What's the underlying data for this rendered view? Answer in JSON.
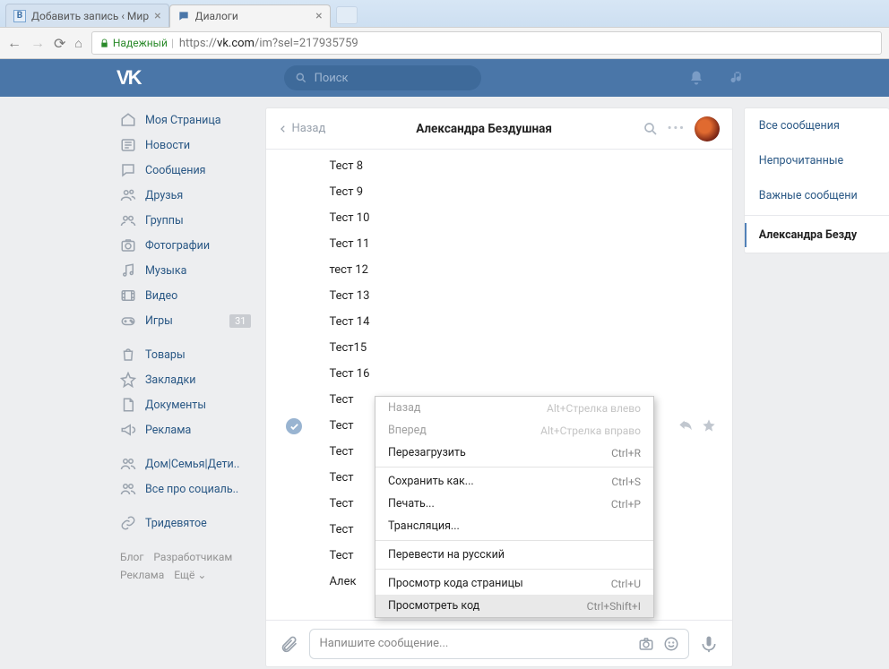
{
  "browser": {
    "tabs": [
      {
        "title": "Добавить запись ‹ Мир",
        "active": false
      },
      {
        "title": "Диалоги",
        "active": true
      }
    ],
    "secure_label": "Надежный",
    "url_scheme": "https://",
    "url_host": "vk.com",
    "url_path": "/im?sel=217935759"
  },
  "header": {
    "search_placeholder": "Поиск"
  },
  "sidebar": {
    "main": [
      {
        "id": "profile",
        "label": "Моя Страница"
      },
      {
        "id": "news",
        "label": "Новости"
      },
      {
        "id": "messages",
        "label": "Сообщения"
      },
      {
        "id": "friends",
        "label": "Друзья"
      },
      {
        "id": "groups",
        "label": "Группы"
      },
      {
        "id": "photos",
        "label": "Фотографии"
      },
      {
        "id": "music",
        "label": "Музыка"
      },
      {
        "id": "videos",
        "label": "Видео"
      },
      {
        "id": "games",
        "label": "Игры",
        "badge": "31"
      }
    ],
    "extra": [
      {
        "id": "market",
        "label": "Товары"
      },
      {
        "id": "bookmarks",
        "label": "Закладки"
      },
      {
        "id": "docs",
        "label": "Документы"
      },
      {
        "id": "ads",
        "label": "Реклама"
      }
    ],
    "communities": [
      {
        "id": "c1",
        "label": "Дом|Семья|Дети.."
      },
      {
        "id": "c2",
        "label": "Все про социаль.."
      }
    ],
    "chain": [
      {
        "id": "c3",
        "label": "Тридевятое"
      }
    ],
    "footer": {
      "blog": "Блог",
      "devs": "Разработчикам",
      "ads": "Реклама",
      "more": "Ещё ⌄"
    }
  },
  "chat": {
    "back": "Назад",
    "title": "Александра Бездушная",
    "messages": [
      "Тест 8",
      "Тест 9",
      "Тест 10",
      "Тест 11",
      "тест 12",
      "Тест 13",
      "Тест 14",
      "Тест15",
      "Тест 16",
      "Тест",
      "Тест",
      "Тест",
      "Тест",
      "Тест",
      "Тест",
      "Тест",
      "Алек"
    ],
    "composer_placeholder": "Напишите сообщение..."
  },
  "filters": {
    "all": "Все сообщения",
    "unread": "Непрочитанные",
    "important": "Важные сообщени",
    "active": "Александра Безду"
  },
  "context_menu": {
    "back": {
      "label": "Назад",
      "shortcut": "Alt+Стрелка влево",
      "disabled": true
    },
    "forward": {
      "label": "Вперед",
      "shortcut": "Alt+Стрелка вправо",
      "disabled": true
    },
    "reload": {
      "label": "Перезагрузить",
      "shortcut": "Ctrl+R"
    },
    "saveas": {
      "label": "Сохранить как...",
      "shortcut": "Ctrl+S"
    },
    "print": {
      "label": "Печать...",
      "shortcut": "Ctrl+P"
    },
    "cast": {
      "label": "Трансляция..."
    },
    "translate": {
      "label": "Перевести на русский"
    },
    "viewsrc": {
      "label": "Просмотр кода страницы",
      "shortcut": "Ctrl+U"
    },
    "inspect": {
      "label": "Просмотреть код",
      "shortcut": "Ctrl+Shift+I",
      "hover": true
    }
  }
}
